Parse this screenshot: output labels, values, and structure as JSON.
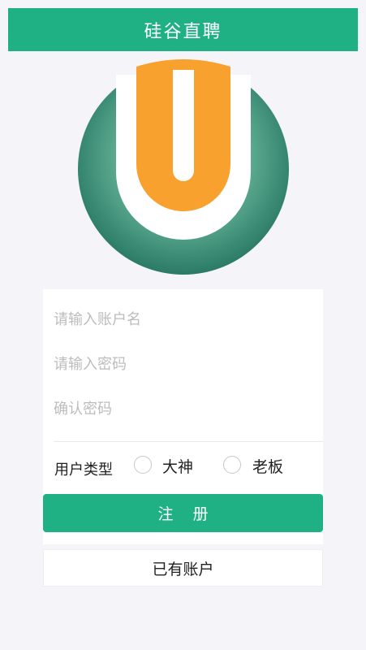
{
  "header": {
    "title": "硅谷直聘"
  },
  "logo": {
    "icon": "u-logo-icon",
    "colors": {
      "ring": "#2f7e6a",
      "u": "#f9a12e"
    }
  },
  "form": {
    "username": {
      "value": "",
      "placeholder": "请输入账户名"
    },
    "password": {
      "value": "",
      "placeholder": "请输入密码"
    },
    "confirm_password": {
      "value": "",
      "placeholder": "确认密码"
    },
    "user_type": {
      "label": "用户类型",
      "options": [
        {
          "label": "大神",
          "selected": false
        },
        {
          "label": "老板",
          "selected": false
        }
      ]
    },
    "register_label": "注册"
  },
  "login_link_label": "已有账户",
  "colors": {
    "primary": "#1fb083",
    "background": "#f5f5f9"
  }
}
